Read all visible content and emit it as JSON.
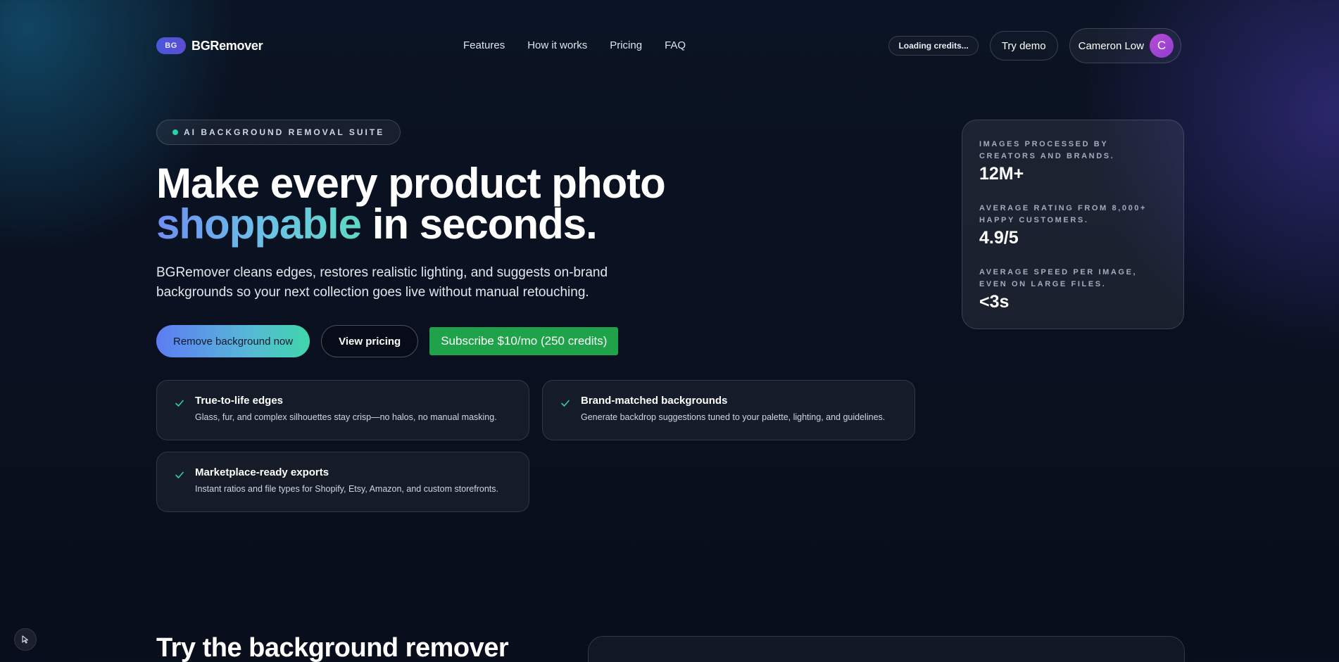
{
  "brand": {
    "badge": "BG",
    "name": "BGRemover"
  },
  "nav": {
    "links": [
      "Features",
      "How it works",
      "Pricing",
      "FAQ"
    ],
    "credits": "Loading credits...",
    "demo_label": "Try demo",
    "user": {
      "name": "Cameron Low",
      "initial": "C"
    }
  },
  "hero": {
    "eyebrow": "AI BACKGROUND REMOVAL SUITE",
    "headline_line1": "Make every product photo",
    "headline_accent": "shoppable",
    "headline_rest": " in seconds.",
    "subtext": "BGRemover cleans edges, restores realistic lighting, and suggests on-brand backgrounds so your next collection goes live without manual retouching.",
    "cta_primary": "Remove background now",
    "cta_secondary": "View pricing",
    "cta_subscribe": "Subscribe $10/mo (250 credits)"
  },
  "features": [
    {
      "title": "True-to-life edges",
      "desc": "Glass, fur, and complex silhouettes stay crisp—no halos, no manual masking."
    },
    {
      "title": "Brand-matched backgrounds",
      "desc": "Generate backdrop suggestions tuned to your palette, lighting, and guidelines."
    },
    {
      "title": "Marketplace-ready exports",
      "desc": "Instant ratios and file types for Shopify, Etsy, Amazon, and custom storefronts."
    }
  ],
  "stats": [
    {
      "label": "Images processed by creators and brands.",
      "value": "12M+"
    },
    {
      "label": "Average rating from 8,000+ happy customers.",
      "value": "4.9/5"
    },
    {
      "label": "Average speed per image, even on large files.",
      "value": "<3s"
    }
  ],
  "section": {
    "title": "Try the background remover"
  },
  "colors": {
    "accent_green": "#1fa34a",
    "check": "#2ad1a4",
    "avatar": "#b84ad7"
  },
  "icons": {
    "feature": "check-icon",
    "corner": "cursor-icon"
  }
}
